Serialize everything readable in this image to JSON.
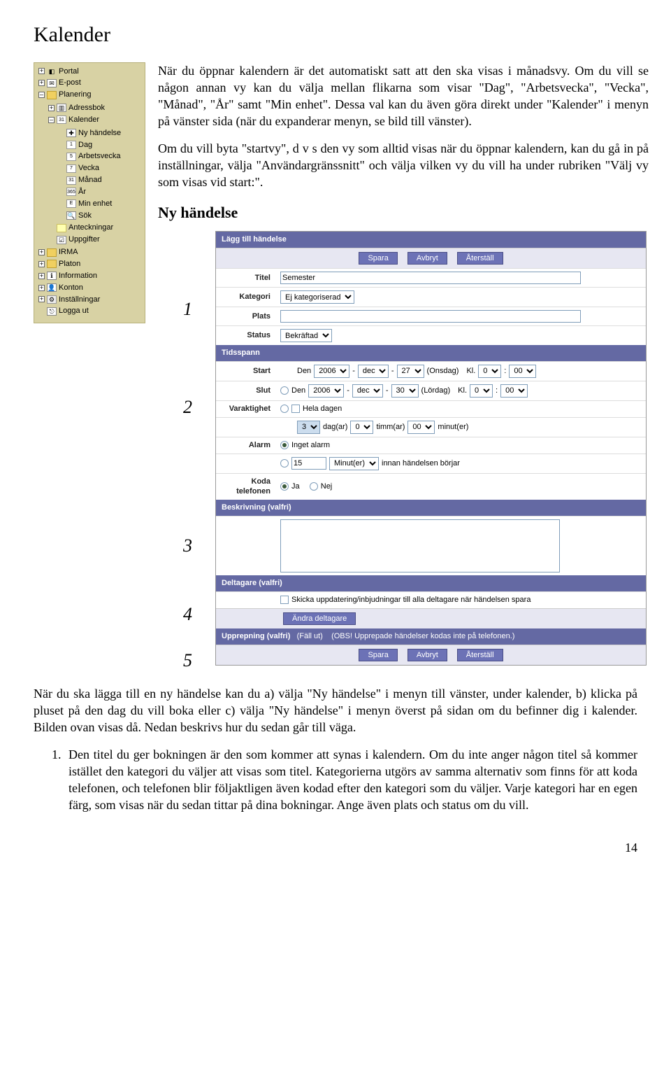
{
  "title": "Kalender",
  "para1": "När du öppnar kalendern är det automatiskt satt att den ska visas i månadsvy. Om du vill se någon annan vy kan du välja mellan flikarna som visar \"Dag\", \"Arbetsvecka\", \"Vecka\", \"Månad\", \"År\" samt \"Min enhet\". Dessa val kan du även göra direkt under \"Kalender\" i menyn på vänster sida (när du expanderar menyn, se bild till vänster).",
  "para2": "Om du vill byta \"startvy\", d v s den vy som alltid visas när du öppnar kalendern, kan du gå in på inställningar, välja \"Användargränssnitt\" och välja vilken vy du vill ha under rubriken \"Välj vy som visas vid start:\".",
  "h2": "Ny händelse",
  "tree": {
    "portal": "Portal",
    "epost": "E-post",
    "planering": "Planering",
    "adressbok": "Adressbok",
    "kalender": "Kalender",
    "nyhandelse": "Ny händelse",
    "dag": "Dag",
    "arbetsvecka": "Arbetsvecka",
    "vecka": "Vecka",
    "manad": "Månad",
    "ar": "År",
    "minenhet": "Min enhet",
    "sok": "Sök",
    "anteckningar": "Anteckningar",
    "uppgifter": "Uppgifter",
    "irma": "IRMA",
    "platon": "Platon",
    "information": "Information",
    "konton": "Konton",
    "installningar": "Inställningar",
    "loggaut": "Logga ut",
    "cal31": "31",
    "cal1": "1",
    "cal5": "5",
    "cal7": "7",
    "cal365": "365",
    "calE": "E"
  },
  "form": {
    "header": "Lägg till händelse",
    "save": "Spara",
    "cancel": "Avbryt",
    "reset": "Återställ",
    "titel_l": "Titel",
    "titel_v": "Semester",
    "kategori_l": "Kategori",
    "kategori_v": "Ej kategoriserad",
    "plats_l": "Plats",
    "status_l": "Status",
    "status_v": "Bekräftad",
    "tidsspann": "Tidsspann",
    "start_l": "Start",
    "slut_l": "Slut",
    "den": "Den",
    "year": "2006",
    "mon": "dec",
    "dstart": "27",
    "dend": "30",
    "wstart": "(Onsdag)",
    "wend": "(Lördag)",
    "kl": "Kl.",
    "hr": "0",
    "min": "00",
    "varaktighet_l": "Varaktighet",
    "heladagen": "Hela dagen",
    "dag_n": "3",
    "dag_l": "dag(ar)",
    "tim_n": "0",
    "tim_l": "timm(ar)",
    "min_n": "00",
    "min_l": "minut(er)",
    "alarm_l": "Alarm",
    "alarm_none": "Inget alarm",
    "alarm_n": "15",
    "alarm_u": "Minut(er)",
    "alarm_t": "innan händelsen börjar",
    "koda_l": "Koda telefonen",
    "ja": "Ja",
    "nej": "Nej",
    "besk": "Beskrivning (valfri)",
    "delt": "Deltagare (valfri)",
    "delt_chk": "Skicka uppdatering/inbjudningar till alla deltagare när händelsen spara",
    "andra": "Ändra deltagare",
    "upp": "Upprepning (valfri)",
    "fallut": "(Fäll ut)",
    "obs": "(OBS! Upprepade händelser kodas inte på telefonen.)"
  },
  "markers": {
    "m1": "1",
    "m2": "2",
    "m3": "3",
    "m4": "4",
    "m5": "5"
  },
  "below1": "När du ska lägga till en ny händelse kan du a) välja \"Ny händelse\" i menyn till vänster, under kalender, b) klicka på pluset på den dag du vill boka eller c) välja \"Ny händelse\" i menyn överst på sidan om du befinner dig i kalender. Bilden ovan visas då. Nedan beskrivs hur du sedan går till väga.",
  "list1": "Den titel du ger bokningen är den som kommer att synas i kalendern. Om du inte anger någon titel så kommer istället den kategori du väljer att visas som titel. Kategorierna utgörs av samma alternativ som finns för att koda telefonen, och telefonen blir följaktligen även kodad efter den kategori som du väljer. Varje kategori har en egen färg, som visas när du sedan tittar på dina bokningar. Ange även plats och status om du vill.",
  "page": "14"
}
